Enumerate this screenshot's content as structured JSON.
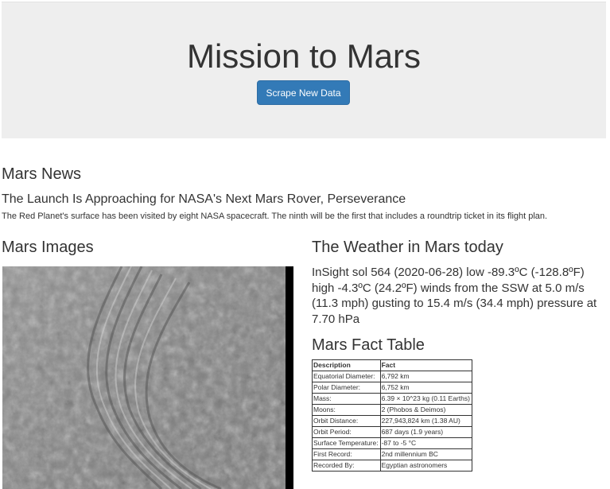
{
  "header": {
    "title": "Mission to Mars",
    "scrape_button_label": "Scrape New Data"
  },
  "news": {
    "section_title": "Mars News",
    "headline": "The Launch Is Approaching for NASA's Next Mars Rover, Perseverance",
    "teaser": "The Red Planet's surface has been visited by eight NASA spacecraft. The ninth will be the first that includes a roundtrip ticket in its flight plan."
  },
  "images": {
    "section_title": "Mars Images"
  },
  "weather": {
    "section_title": "The Weather in Mars today",
    "report": "InSight sol 564 (2020-06-28) low -89.3ºC (-128.8ºF) high -4.3ºC (24.2ºF) winds from the SSW at 5.0 m/s (11.3 mph) gusting to 15.4 m/s (34.4 mph) pressure at 7.70 hPa"
  },
  "facts": {
    "section_title": "Mars Fact Table",
    "headers": [
      "Description",
      "Fact"
    ],
    "rows": [
      [
        "Equatorial Diameter:",
        "6,792 km"
      ],
      [
        "Polar Diameter:",
        "6,752 km"
      ],
      [
        "Mass:",
        "6.39 × 10^23 kg (0.11 Earths)"
      ],
      [
        "Moons:",
        "2 (Phobos & Deimos)"
      ],
      [
        "Orbit Distance:",
        "227,943,824 km (1.38 AU)"
      ],
      [
        "Orbit Period:",
        "687 days (1.9 years)"
      ],
      [
        "Surface Temperature:",
        "-87 to -5 °C"
      ],
      [
        "First Record:",
        "2nd millennium BC"
      ],
      [
        "Recorded By:",
        "Egyptian astronomers"
      ]
    ]
  }
}
